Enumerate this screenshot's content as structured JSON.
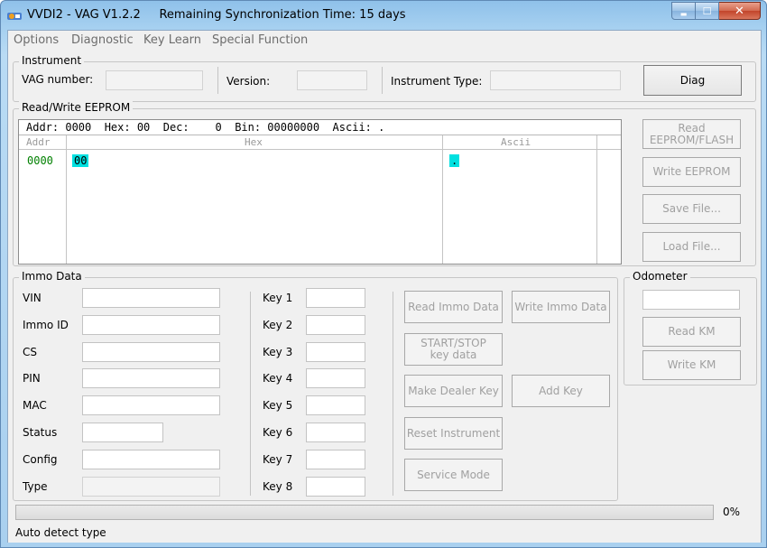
{
  "window": {
    "app_name": "VVDI2 - VAG V1.2.2",
    "sync_text": "Remaining Synchronization Time: 15 days",
    "min_glyph": "▬",
    "max_glyph": "☐",
    "close_glyph": "✕"
  },
  "menu": [
    "Options",
    "Diagnostic",
    "Key Learn",
    "Special Function"
  ],
  "instrument": {
    "group_label": "Instrument",
    "vag_number_label": "VAG number:",
    "vag_number_value": "",
    "version_label": "Version:",
    "version_value": "",
    "type_label": "Instrument Type:",
    "type_value": "",
    "diag_button": "Diag"
  },
  "eeprom": {
    "group_label": "Read/Write EEPROM",
    "header": "Addr: 0000  Hex: 00  Dec:    0  Bin: 00000000  Ascii: .",
    "col_addr": "Addr",
    "col_hex": "Hex",
    "col_ascii": "Ascii",
    "row_addr": "0000",
    "row_hex": "00",
    "row_ascii": ".",
    "buttons": {
      "read": "Read EEPROM/FLASH",
      "write": "Write EEPROM",
      "save": "Save File...",
      "load": "Load File..."
    }
  },
  "immo": {
    "group_label": "Immo Data",
    "fields": [
      {
        "label": "VIN",
        "value": ""
      },
      {
        "label": "Immo ID",
        "value": ""
      },
      {
        "label": "CS",
        "value": ""
      },
      {
        "label": "PIN",
        "value": ""
      },
      {
        "label": "MAC",
        "value": ""
      },
      {
        "label": "Status",
        "value": ""
      },
      {
        "label": "Config",
        "value": ""
      },
      {
        "label": "Type",
        "value": ""
      }
    ],
    "keys": [
      "Key 1",
      "Key 2",
      "Key 3",
      "Key 4",
      "Key 5",
      "Key 6",
      "Key 7",
      "Key 8"
    ],
    "buttons": {
      "read_immo": "Read Immo Data",
      "write_immo": "Write Immo Data",
      "start_stop": "START/STOP key data",
      "make_dealer": "Make Dealer Key",
      "add_key": "Add Key",
      "reset_instrument": "Reset Instrument",
      "service_mode": "Service Mode"
    }
  },
  "odometer": {
    "group_label": "Odometer",
    "value": "",
    "read_km": "Read KM",
    "write_km": "Write KM"
  },
  "progress": {
    "percent_text": "0%",
    "value": 0
  },
  "status": {
    "text": "Auto detect type"
  },
  "colors": {
    "title_bar": "#a6d0f0",
    "hex_highlight": "#00e0e0",
    "addr_green": "#008000",
    "disabled_text": "#a0a0a0"
  }
}
